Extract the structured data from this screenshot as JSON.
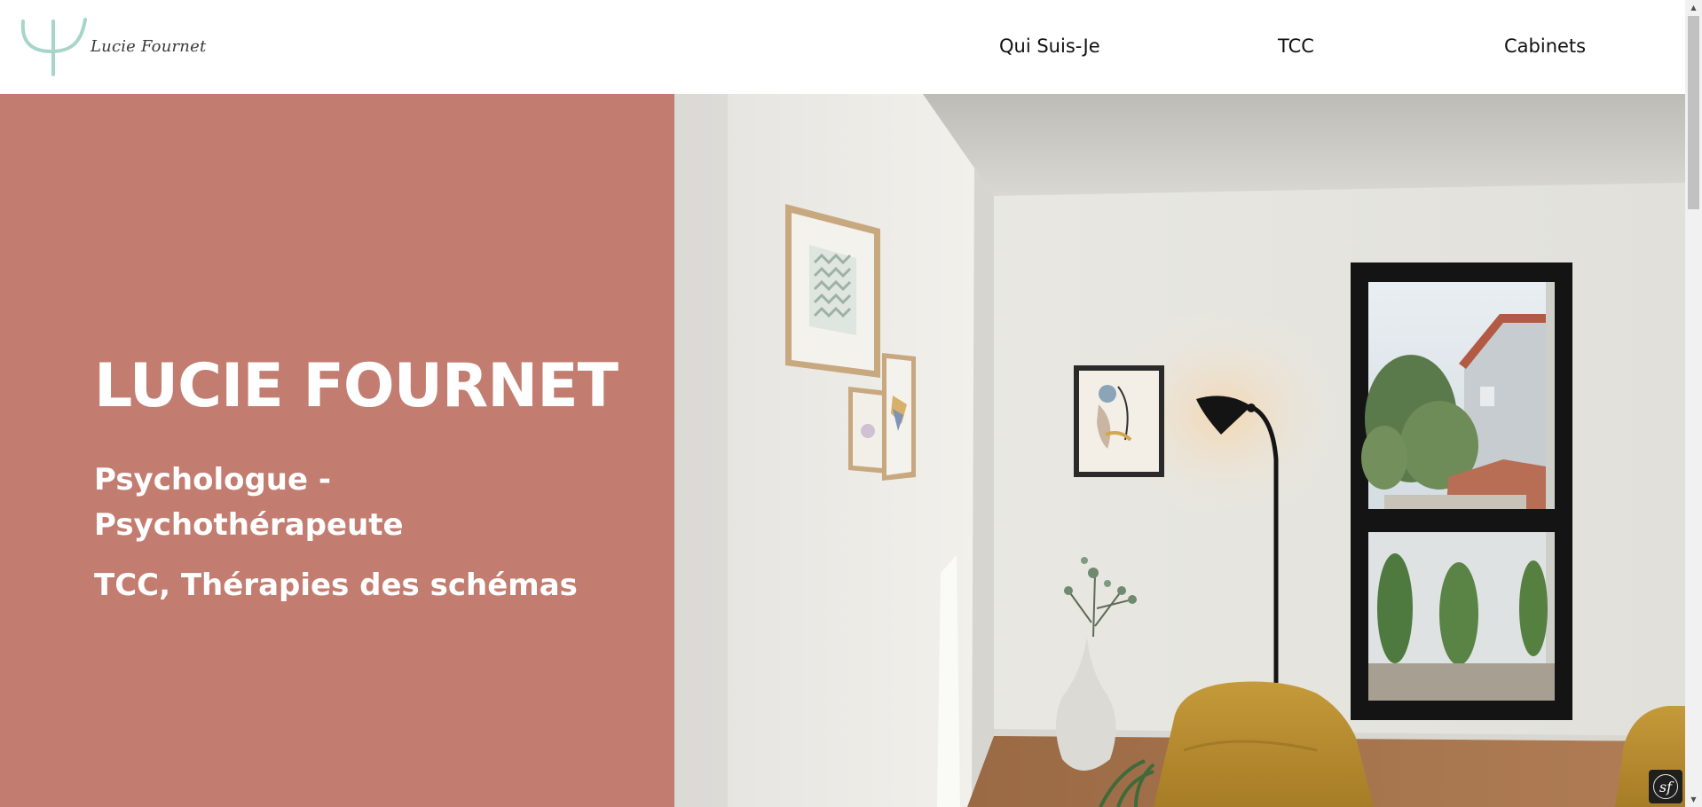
{
  "header": {
    "logo_text": "Lucie Fournet",
    "nav": {
      "about": "Qui Suis-Je",
      "tcc": "TCC",
      "offices": "Cabinets"
    }
  },
  "hero": {
    "title": "LUCIE FOURNET",
    "subtitle": "Psychologue - Psychothérapeute",
    "specialties": "TCC, Thérapies des schémas",
    "panel_color": "#c27d70"
  },
  "toolbar": {
    "badge_label": "sf"
  },
  "colors": {
    "logo_accent": "#a8d5c9",
    "text_dark": "#111111",
    "white": "#ffffff"
  },
  "icons": {
    "logo": "psi-logo-icon",
    "toolbar": "symfony-toolbar-icon"
  }
}
